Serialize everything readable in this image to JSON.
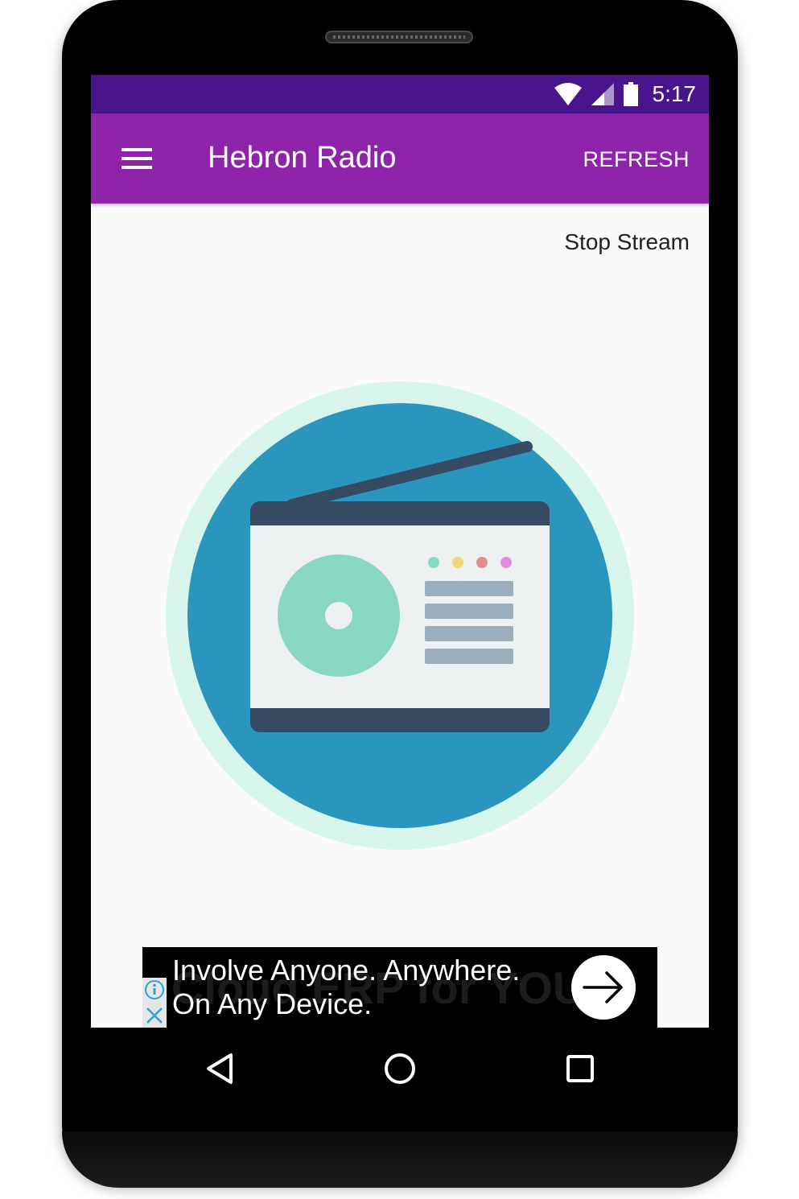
{
  "status_bar": {
    "time": "5:17",
    "icons": [
      "wifi-icon",
      "signal-icon",
      "battery-icon"
    ],
    "color": "#4a148c"
  },
  "app_bar": {
    "title": "Hebron Radio",
    "refresh_label": "REFRESH",
    "color": "#8e24aa",
    "menu_icon": "menu-icon"
  },
  "main": {
    "stop_stream_label": "Stop Stream",
    "illustration": "radio-icon"
  },
  "ad": {
    "line1": "Involve Anyone. Anywhere.",
    "line2": "On Any Device.",
    "background_text": "Cloud ERP for YOU",
    "icons": [
      "info-icon",
      "close-icon",
      "arrow-right-icon"
    ]
  },
  "nav_bar": {
    "icons": [
      "back-icon",
      "home-icon",
      "recents-icon"
    ]
  }
}
